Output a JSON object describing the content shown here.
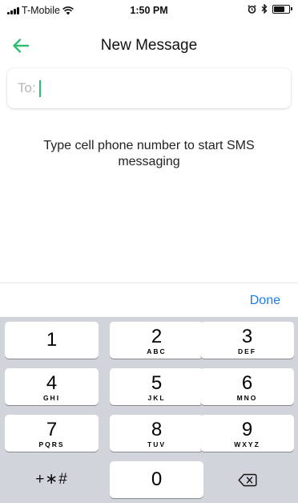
{
  "status_bar": {
    "carrier": "T-Mobile",
    "time": "1:50 PM",
    "signal_bars": 4,
    "battery_level": 0.8
  },
  "nav": {
    "title": "New Message",
    "back_icon": "arrow-left-icon",
    "accent_color": "#2fbf72"
  },
  "compose": {
    "to_label": "To:",
    "to_value": "",
    "hint": "Type cell phone number to start SMS messaging"
  },
  "toolbar": {
    "done_label": "Done",
    "done_color": "#1a7cf5"
  },
  "keypad": {
    "keys": [
      {
        "digit": "1",
        "letters": ""
      },
      {
        "digit": "2",
        "letters": "ABC"
      },
      {
        "digit": "3",
        "letters": "DEF"
      },
      {
        "digit": "4",
        "letters": "GHI"
      },
      {
        "digit": "5",
        "letters": "JKL"
      },
      {
        "digit": "6",
        "letters": "MNO"
      },
      {
        "digit": "7",
        "letters": "PQRS"
      },
      {
        "digit": "8",
        "letters": "TUV"
      },
      {
        "digit": "9",
        "letters": "WXYZ"
      },
      {
        "digit": "0",
        "letters": ""
      }
    ],
    "symbols_label": "+∗#",
    "backspace_icon": "backspace-icon"
  }
}
